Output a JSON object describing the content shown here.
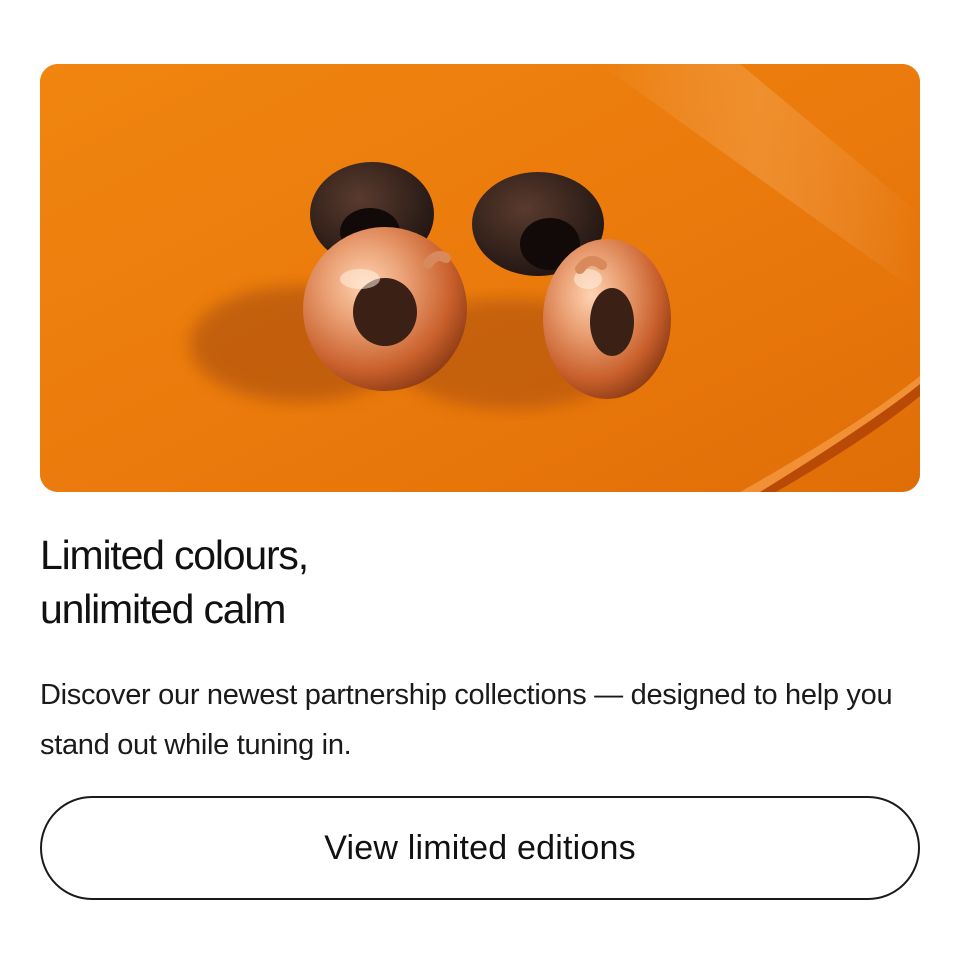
{
  "hero": {
    "image_name": "loop-earplugs-orange-photo",
    "background_color": "#e8780f",
    "earplug_color": "#e08a55"
  },
  "headline": {
    "line1": "Limited colours,",
    "line2": "unlimited calm"
  },
  "description": "Discover our newest partnership collections — designed to help you stand out while tuning in.",
  "cta": {
    "label": "View limited editions"
  }
}
